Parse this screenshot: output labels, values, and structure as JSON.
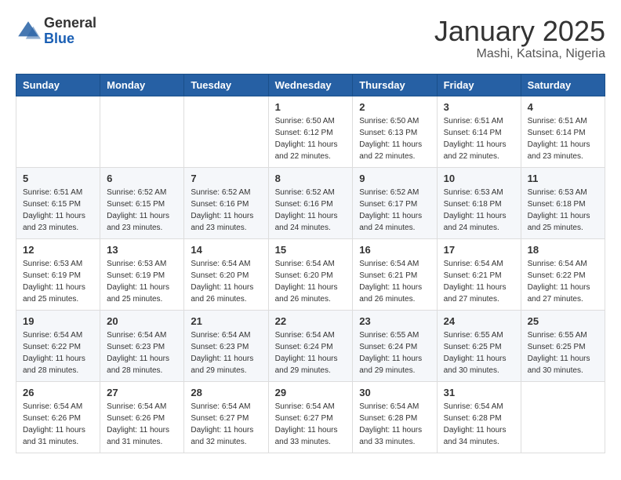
{
  "header": {
    "logo_general": "General",
    "logo_blue": "Blue",
    "month_year": "January 2025",
    "location": "Mashi, Katsina, Nigeria"
  },
  "days_of_week": [
    "Sunday",
    "Monday",
    "Tuesday",
    "Wednesday",
    "Thursday",
    "Friday",
    "Saturday"
  ],
  "weeks": [
    [
      {
        "day": "",
        "info": ""
      },
      {
        "day": "",
        "info": ""
      },
      {
        "day": "",
        "info": ""
      },
      {
        "day": "1",
        "info": "Sunrise: 6:50 AM\nSunset: 6:12 PM\nDaylight: 11 hours and 22 minutes."
      },
      {
        "day": "2",
        "info": "Sunrise: 6:50 AM\nSunset: 6:13 PM\nDaylight: 11 hours and 22 minutes."
      },
      {
        "day": "3",
        "info": "Sunrise: 6:51 AM\nSunset: 6:14 PM\nDaylight: 11 hours and 22 minutes."
      },
      {
        "day": "4",
        "info": "Sunrise: 6:51 AM\nSunset: 6:14 PM\nDaylight: 11 hours and 23 minutes."
      }
    ],
    [
      {
        "day": "5",
        "info": "Sunrise: 6:51 AM\nSunset: 6:15 PM\nDaylight: 11 hours and 23 minutes."
      },
      {
        "day": "6",
        "info": "Sunrise: 6:52 AM\nSunset: 6:15 PM\nDaylight: 11 hours and 23 minutes."
      },
      {
        "day": "7",
        "info": "Sunrise: 6:52 AM\nSunset: 6:16 PM\nDaylight: 11 hours and 23 minutes."
      },
      {
        "day": "8",
        "info": "Sunrise: 6:52 AM\nSunset: 6:16 PM\nDaylight: 11 hours and 24 minutes."
      },
      {
        "day": "9",
        "info": "Sunrise: 6:52 AM\nSunset: 6:17 PM\nDaylight: 11 hours and 24 minutes."
      },
      {
        "day": "10",
        "info": "Sunrise: 6:53 AM\nSunset: 6:18 PM\nDaylight: 11 hours and 24 minutes."
      },
      {
        "day": "11",
        "info": "Sunrise: 6:53 AM\nSunset: 6:18 PM\nDaylight: 11 hours and 25 minutes."
      }
    ],
    [
      {
        "day": "12",
        "info": "Sunrise: 6:53 AM\nSunset: 6:19 PM\nDaylight: 11 hours and 25 minutes."
      },
      {
        "day": "13",
        "info": "Sunrise: 6:53 AM\nSunset: 6:19 PM\nDaylight: 11 hours and 25 minutes."
      },
      {
        "day": "14",
        "info": "Sunrise: 6:54 AM\nSunset: 6:20 PM\nDaylight: 11 hours and 26 minutes."
      },
      {
        "day": "15",
        "info": "Sunrise: 6:54 AM\nSunset: 6:20 PM\nDaylight: 11 hours and 26 minutes."
      },
      {
        "day": "16",
        "info": "Sunrise: 6:54 AM\nSunset: 6:21 PM\nDaylight: 11 hours and 26 minutes."
      },
      {
        "day": "17",
        "info": "Sunrise: 6:54 AM\nSunset: 6:21 PM\nDaylight: 11 hours and 27 minutes."
      },
      {
        "day": "18",
        "info": "Sunrise: 6:54 AM\nSunset: 6:22 PM\nDaylight: 11 hours and 27 minutes."
      }
    ],
    [
      {
        "day": "19",
        "info": "Sunrise: 6:54 AM\nSunset: 6:22 PM\nDaylight: 11 hours and 28 minutes."
      },
      {
        "day": "20",
        "info": "Sunrise: 6:54 AM\nSunset: 6:23 PM\nDaylight: 11 hours and 28 minutes."
      },
      {
        "day": "21",
        "info": "Sunrise: 6:54 AM\nSunset: 6:23 PM\nDaylight: 11 hours and 29 minutes."
      },
      {
        "day": "22",
        "info": "Sunrise: 6:54 AM\nSunset: 6:24 PM\nDaylight: 11 hours and 29 minutes."
      },
      {
        "day": "23",
        "info": "Sunrise: 6:55 AM\nSunset: 6:24 PM\nDaylight: 11 hours and 29 minutes."
      },
      {
        "day": "24",
        "info": "Sunrise: 6:55 AM\nSunset: 6:25 PM\nDaylight: 11 hours and 30 minutes."
      },
      {
        "day": "25",
        "info": "Sunrise: 6:55 AM\nSunset: 6:25 PM\nDaylight: 11 hours and 30 minutes."
      }
    ],
    [
      {
        "day": "26",
        "info": "Sunrise: 6:54 AM\nSunset: 6:26 PM\nDaylight: 11 hours and 31 minutes."
      },
      {
        "day": "27",
        "info": "Sunrise: 6:54 AM\nSunset: 6:26 PM\nDaylight: 11 hours and 31 minutes."
      },
      {
        "day": "28",
        "info": "Sunrise: 6:54 AM\nSunset: 6:27 PM\nDaylight: 11 hours and 32 minutes."
      },
      {
        "day": "29",
        "info": "Sunrise: 6:54 AM\nSunset: 6:27 PM\nDaylight: 11 hours and 33 minutes."
      },
      {
        "day": "30",
        "info": "Sunrise: 6:54 AM\nSunset: 6:28 PM\nDaylight: 11 hours and 33 minutes."
      },
      {
        "day": "31",
        "info": "Sunrise: 6:54 AM\nSunset: 6:28 PM\nDaylight: 11 hours and 34 minutes."
      },
      {
        "day": "",
        "info": ""
      }
    ]
  ]
}
